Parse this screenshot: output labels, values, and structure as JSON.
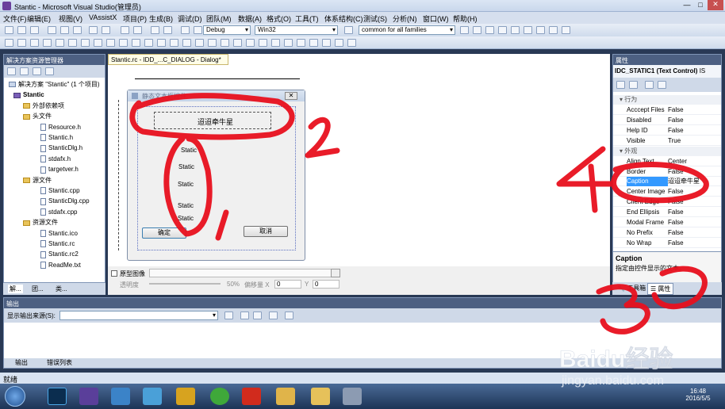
{
  "window": {
    "title": "Stantic - Microsoft Visual Studio(管理员)"
  },
  "menu": [
    "文件(F)",
    "编辑(E)",
    "视图(V)",
    "VAssistX",
    "项目(P)",
    "生成(B)",
    "调试(D)",
    "团队(M)",
    "数据(A)",
    "格式(O)",
    "工具(T)",
    "体系结构(C)",
    "测试(S)",
    "分析(N)",
    "窗口(W)",
    "帮助(H)"
  ],
  "toolbar": {
    "config": "Debug",
    "platform": "Win32",
    "find": "common for all families"
  },
  "solution_explorer": {
    "title": "解决方案资源管理器",
    "items": [
      {
        "label": "解决方案 \"Stantic\" (1 个项目)",
        "kind": "solution"
      },
      {
        "label": "Stantic",
        "kind": "project"
      },
      {
        "label": "外部依赖项",
        "kind": "folder"
      },
      {
        "label": "头文件",
        "kind": "folder"
      },
      {
        "label": "Resource.h",
        "kind": "file"
      },
      {
        "label": "Stantic.h",
        "kind": "file"
      },
      {
        "label": "StanticDlg.h",
        "kind": "file"
      },
      {
        "label": "stdafx.h",
        "kind": "file"
      },
      {
        "label": "targetver.h",
        "kind": "file"
      },
      {
        "label": "源文件",
        "kind": "folder"
      },
      {
        "label": "Stantic.cpp",
        "kind": "file"
      },
      {
        "label": "StanticDlg.cpp",
        "kind": "file"
      },
      {
        "label": "stdafx.cpp",
        "kind": "file"
      },
      {
        "label": "资源文件",
        "kind": "folder"
      },
      {
        "label": "Stantic.ico",
        "kind": "file"
      },
      {
        "label": "Stantic.rc",
        "kind": "file"
      },
      {
        "label": "Stantic.rc2",
        "kind": "file"
      },
      {
        "label": "ReadMe.txt",
        "kind": "file"
      }
    ],
    "tabs": [
      "解...",
      "团...",
      "类..."
    ]
  },
  "editor": {
    "tab": "Stantic.rc - IDD_...C_DIALOG - Dialog*",
    "dialog_title": "静态文本框控件",
    "caption_static": "迢迢牵牛星",
    "statics": [
      "Static",
      "Static",
      "Static",
      "Static",
      "Static"
    ],
    "ok": "确定",
    "cancel": "取消",
    "bottom": {
      "prototype": "原型图像",
      "transparency": "透明度",
      "percent": "50%",
      "offset_x": "偏移量 X",
      "x_val": "0",
      "y_label": "Y",
      "y_val": "0"
    }
  },
  "properties": {
    "title": "属性",
    "object": "IDC_STATIC1 (Text Control)",
    "object_suffix": "IS",
    "categories": [
      {
        "name": "行为",
        "rows": [
          {
            "k": "Acccept Files",
            "v": "False"
          },
          {
            "k": "Disabled",
            "v": "False"
          },
          {
            "k": "Help ID",
            "v": "False"
          },
          {
            "k": "Visible",
            "v": "True"
          }
        ]
      },
      {
        "name": "外观",
        "rows": [
          {
            "k": "Align Text",
            "v": "Center"
          },
          {
            "k": "Border",
            "v": "False"
          },
          {
            "k": "Caption",
            "v": "迢迢牵牛星"
          },
          {
            "k": "Center Image",
            "v": "False"
          },
          {
            "k": "Client Edge",
            "v": "False"
          },
          {
            "k": "End Ellipsis",
            "v": "False"
          },
          {
            "k": "Modal Frame",
            "v": "False"
          },
          {
            "k": "No Prefix",
            "v": "False"
          },
          {
            "k": "No Wrap",
            "v": "False"
          }
        ]
      }
    ],
    "desc_title": "Caption",
    "desc_text": "指定由控件显示的文本。",
    "tabs": [
      "工具箱",
      "属性"
    ]
  },
  "output": {
    "title": "输出",
    "source_label": "显示输出来源(S):",
    "tabs": [
      "输出",
      "错误列表"
    ]
  },
  "status": "就绪",
  "clock": {
    "time": "16:48",
    "date": "2016/5/5"
  },
  "annotations": [
    "1",
    "2",
    "3",
    "4"
  ],
  "watermark": {
    "brand": "Baidu经验",
    "url": "jingyan.baidu.com"
  }
}
